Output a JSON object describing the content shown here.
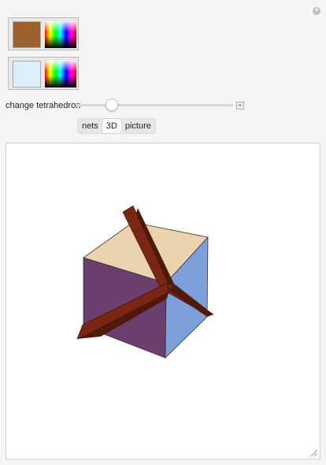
{
  "header": {
    "expand_icon": "plus-circle-icon"
  },
  "color_controls": [
    {
      "swatch_color": "#9c602f",
      "picker": "spectrum-color-picker"
    },
    {
      "swatch_color": "#ddeefb",
      "picker": "spectrum-color-picker"
    }
  ],
  "slider": {
    "label": "change tetrahedron",
    "value_fraction": 0.23
  },
  "view_tabs": {
    "options": [
      "nets",
      "3D",
      "picture"
    ],
    "selected": "3D"
  },
  "graphic": {
    "colors": {
      "cube_top": "#ebd3af",
      "cube_left": "#6b3e6d",
      "cube_right": "#7d9fda",
      "tetra_frame": "#7a2612",
      "tetra_frame_dark": "#4f1a0c"
    }
  }
}
